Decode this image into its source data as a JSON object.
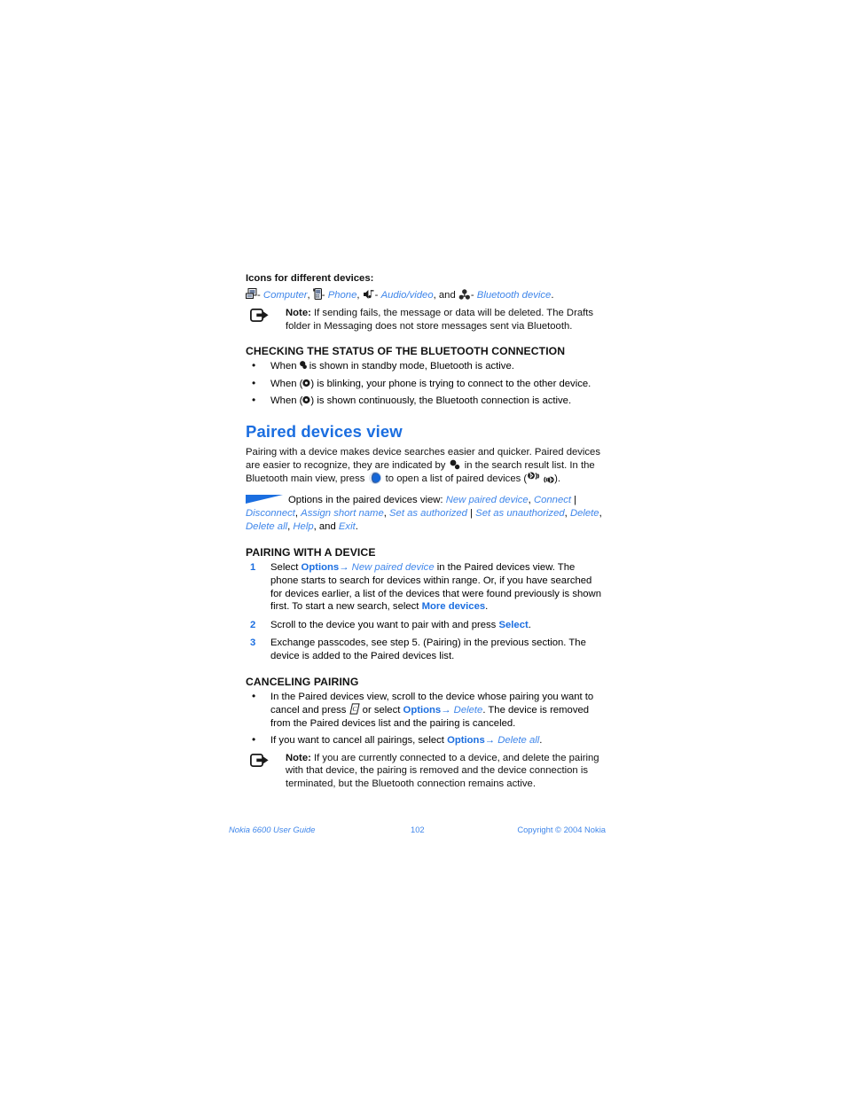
{
  "document": {
    "title": "Nokia 6600 User Guide",
    "page_number": "102",
    "copyright": "Copyright © 2004 Nokia"
  },
  "icons_section": {
    "lead_in": "Icons for different devices:",
    "dash": "-",
    "comma": ",",
    "and": ", and",
    "period": ".",
    "items": [
      {
        "icon": "computer-icon",
        "label": "Computer"
      },
      {
        "icon": "phone-icon",
        "label": "Phone"
      },
      {
        "icon": "audio-video-icon",
        "label": "Audio/video"
      },
      {
        "icon": "bluetooth-device-icon",
        "label": "Bluetooth device"
      }
    ]
  },
  "note_1": {
    "label": "Note:",
    "text": " If sending fails, the message or data will be deleted. The Drafts folder in Messaging does not store messages sent via Bluetooth."
  },
  "status_section": {
    "heading": "CHECKING THE STATUS OF THE BLUETOOTH CONNECTION",
    "bullets": [
      {
        "pre": "When ",
        "post": " is shown in standby mode, Bluetooth is active."
      },
      {
        "pre": "When (",
        "post": ") is blinking, your phone is trying to connect to the other device."
      },
      {
        "pre": "When (",
        "post": ") is shown continuously, the Bluetooth connection is active."
      }
    ]
  },
  "paired_devices": {
    "heading": "Paired devices view",
    "para_1a": "Pairing with a device makes device searches easier and quicker. Paired devices are easier to recognize, they are indicated by ",
    "para_1b": " in the search result list. In the Bluetooth main view, press ",
    "para_1c": " to open a list of paired devices (",
    "para_1d": ")."
  },
  "options_tip": {
    "intro": "Options in the paired devices view: ",
    "items": [
      "New paired device",
      "Connect",
      "Disconnect",
      "Assign short name",
      "Set as authorized",
      "Set as unauthorized",
      "Delete",
      "Delete all",
      "Help",
      "Exit"
    ],
    "pipe": " | ",
    "comma": ", ",
    "and": ", and ",
    "period": "."
  },
  "pairing_section": {
    "heading": "PAIRING WITH A DEVICE",
    "steps": [
      {
        "t1": "Select ",
        "cmd": "Options",
        "arrow": "→",
        "target": "New paired device",
        "t2": " in the Paired devices view. The phone starts to search for devices within range. Or, if you have searched for devices earlier, a list of the devices that were found previously is shown first. To start a new search, select ",
        "cmd2": "More devices",
        "t3": "."
      },
      {
        "t1": "Scroll to the device you want to pair with and press ",
        "cmd": "Select",
        "t3": "."
      },
      {
        "t1": "Exchange passcodes, see step 5. (Pairing) in the previous section. The device is added to the Paired devices list."
      }
    ]
  },
  "canceling_section": {
    "heading": "CANCELING PAIRING",
    "bullet_1": {
      "t1": "In the Paired devices view, scroll to the device whose pairing you want to cancel and press ",
      "t2": " or select ",
      "cmd": "Options",
      "arrow": "→",
      "target": "Delete",
      "t3": ". The device is removed from the Paired devices list and the pairing is canceled."
    },
    "bullet_2": {
      "t1": "If you want to cancel all pairings, select ",
      "cmd": "Options",
      "arrow": "→",
      "target": "Delete all",
      "t3": "."
    }
  },
  "note_2": {
    "label": "Note:",
    "text": " If you are currently connected to a device, and delete the pairing with that device, the pairing is removed and the device connection is terminated, but the Bluetooth connection remains active."
  },
  "colors": {
    "accent_blue": "#1b6ee0",
    "link_blue": "#3f86ea",
    "text_black": "#111111",
    "page_background": "#ffffff"
  }
}
